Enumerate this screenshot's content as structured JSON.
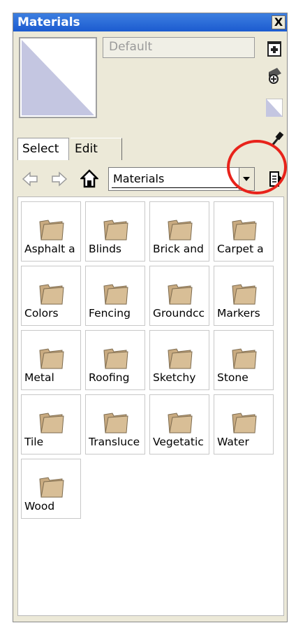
{
  "window": {
    "title": "Materials",
    "close_label": "X"
  },
  "material": {
    "name": "Default"
  },
  "tabs": [
    {
      "label": "Select"
    },
    {
      "label": "Edit"
    }
  ],
  "library": {
    "selected": "Materials"
  },
  "folders": [
    {
      "label": "Asphalt a"
    },
    {
      "label": "Blinds"
    },
    {
      "label": "Brick and"
    },
    {
      "label": "Carpet a"
    },
    {
      "label": "Colors"
    },
    {
      "label": "Fencing"
    },
    {
      "label": "Groundcc"
    },
    {
      "label": "Markers"
    },
    {
      "label": "Metal"
    },
    {
      "label": "Roofing"
    },
    {
      "label": "Sketchy"
    },
    {
      "label": "Stone"
    },
    {
      "label": "Tile"
    },
    {
      "label": "Transluce"
    },
    {
      "label": "Vegetatic"
    },
    {
      "label": "Water"
    },
    {
      "label": "Wood"
    }
  ],
  "colors": {
    "swatch": "#c4c6e1",
    "folder": "#c8aa80",
    "highlight": "#e8231b",
    "title_bar": "#2a68d8"
  },
  "icons": [
    "back-icon",
    "forward-icon",
    "home-icon",
    "dropdown-arrow-icon",
    "details-icon",
    "create-material-icon",
    "paint-bucket-icon",
    "eyedropper-icon",
    "folder-icon"
  ]
}
